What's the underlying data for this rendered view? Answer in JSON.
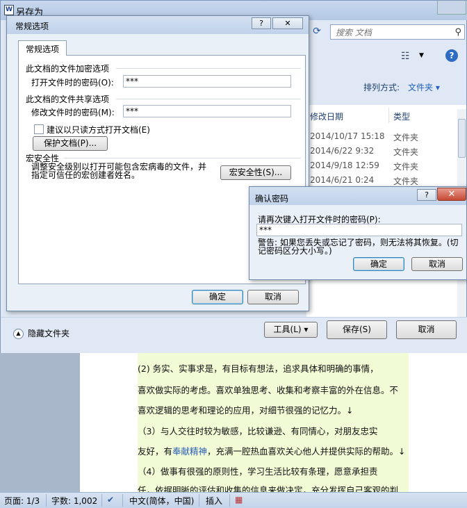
{
  "document": {
    "lines": [
      {
        "before": "(2) 务实、实事求是，有目标有想法，追求具体和明确的事情，",
        "highlight": "",
        "after": ""
      },
      {
        "before": "喜欢做实际的考虑。喜欢单独思考、收集和考察丰富的外在信息。不",
        "highlight": "",
        "after": ""
      },
      {
        "before": "喜欢逻辑的思考和理论的应用，对细节很强的记忆力。↓",
        "highlight": "",
        "after": ""
      },
      {
        "before": "（3）与人交往时较为敏感，比较谦逊、有同情心，对朋友忠实",
        "highlight": "",
        "after": ""
      },
      {
        "before": "友好，有",
        "highlight": "奉献精神",
        "after": "，充满一腔热血喜欢关心他人并提供实际的帮助。↓"
      },
      {
        "before": "（4）做事有很强的原则性，学习生活比较有条理，愿意承担责",
        "highlight": "",
        "after": ""
      },
      {
        "before": "任，依据明晰的评估和收集的信息来做决定，充分发挥自己客观的判",
        "highlight": "",
        "after": ""
      }
    ]
  },
  "statusbar": {
    "page": "页面: 1/3",
    "words": "字数: 1,002",
    "language": "中文(简体，中国)",
    "mode": "插入"
  },
  "saveas": {
    "title": "另存为",
    "word_icon_letter": "W",
    "search_placeholder": "搜索 文档",
    "arrange_label": "排列方式:",
    "arrange_value": "文件夹 ▾",
    "columns": {
      "date": "修改日期",
      "type": "类型"
    },
    "files": [
      {
        "date": "2014/10/17 15:18",
        "type": "文件夹"
      },
      {
        "date": "2014/6/22 9:32",
        "type": "文件夹"
      },
      {
        "date": "2014/9/18 12:59",
        "type": "文件夹"
      },
      {
        "date": "2014/6/21 0:24",
        "type": "文件夹"
      }
    ],
    "hide_folders": "隐藏文件夹",
    "tools_button": "工具(L)  ▾",
    "save_button": "保存(S)",
    "cancel_button": "取消"
  },
  "options_dialog": {
    "title": "常规选项",
    "help_symbol": "?",
    "close_symbol": "✕",
    "tab_label": "常规选项",
    "encrypt_group": "此文档的文件加密选项",
    "open_pwd_label": "打开文件时的密码(O):",
    "open_pwd_value": "***",
    "share_group": "此文档的文件共享选项",
    "modify_pwd_label": "修改文件时的密码(M):",
    "modify_pwd_value": "***",
    "readonly_label": "建议以只读方式打开文档(E)",
    "protect_button": "保护文档(P)...",
    "macro_group": "宏安全性",
    "macro_desc": "调整安全级别以打开可能包含宏病毒的文件，并指定可信任的宏创建者姓名。",
    "macro_button": "宏安全性(S)...",
    "ok_button": "确定",
    "cancel_button": "取消"
  },
  "confirm_dialog": {
    "title": "确认密码",
    "help_symbol": "?",
    "close_symbol": "✕",
    "prompt": "请再次键入打开文件时的密码(P):",
    "value": "***",
    "warning": "警告: 如果您丢失或忘记了密码，则无法将其恢复。(切记密码区分大小写。)",
    "ok_button": "确定",
    "cancel_button": "取消"
  },
  "colors": {
    "accent": "#1f5fbf",
    "highlight_bg": "#f1fbd6",
    "close_red": "#c64a34"
  }
}
